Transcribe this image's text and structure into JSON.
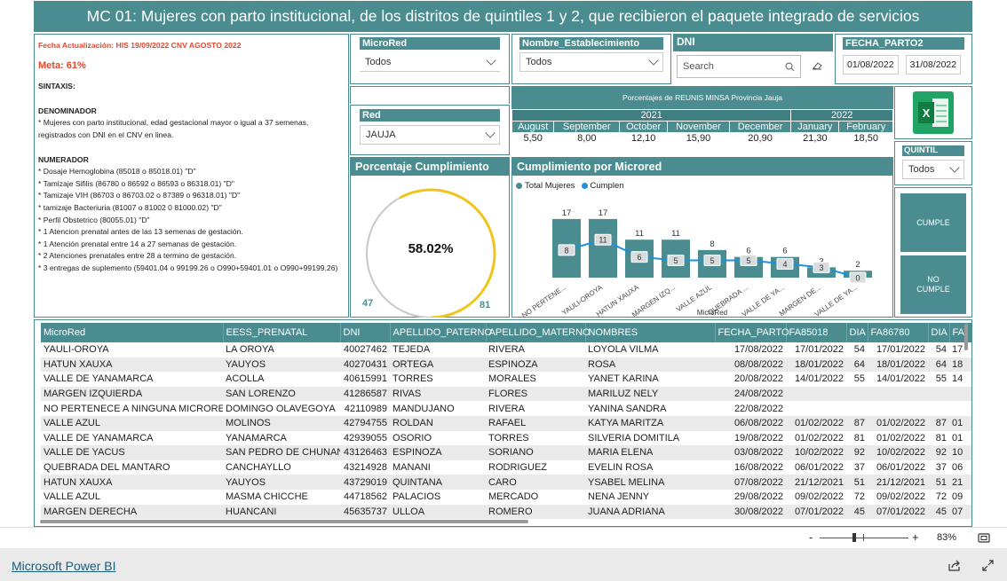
{
  "title": "MC 01: Mujeres con parto institucional, de los distritos de quintiles 1 y 2, que  recibieron el paquete integrado de servicios",
  "info": {
    "update": "Fecha Actualización:  HIS 19/09/2022  CNV AGOSTO 2022",
    "meta": "Meta: 61%",
    "sintaxis": "SINTAXIS:",
    "denominador_title": "DENOMINADOR",
    "denominador_text": "* Mujeres con parto institucional, edad gestacional mayor o igual a 37 semenas, registrados con DNI en el CNV en linea.",
    "numerador_title": "NUMERADOR",
    "numerador_items": [
      "*  Dosaje Hemoglobina (85018 o 85018.01) \"D\"",
      "* Tamizaje Sifilis (86780 o 86592 o 86593 o 86318.01) \"D\"",
      "* Tamizaje VIH (86703 o 86703.02 o 87389 o 96318.01) \"D\"",
      "* tamizaje Bacteriuria (81007 o 81002 0 81000.02) \"D\"",
      "* Perfil Obstetrico (80055.01) \"D\"",
      "* 1 Atencion prenatal antes de las 13 semenas de gestación.",
      "* 1 Atención prenatal entre 14 a 27 semanas de gestación.",
      "* 2 Atenciones prenatales entre 28 a termino de gestación.",
      "* 3 entregas de suplemento (59401.04 o 99199.26 o O990+59401.01 o O990+99199.26)"
    ]
  },
  "slicers": {
    "microred_label": "MicroRed",
    "microred_value": "Todos",
    "establecimiento_label": "Nombre_Establecimiento",
    "establecimiento_value": "Todos",
    "dni_label": "DNI",
    "dni_placeholder": "Search",
    "fecha_label": "FECHA_PARTO2",
    "fecha_from": "01/08/2022",
    "fecha_to": "31/08/2022",
    "red_label": "Red",
    "red_value": "JAUJA",
    "quintil_label": "QUINTIL",
    "quintil_value": "Todos"
  },
  "pct_table": {
    "title": "Porcentajes de REUNIS MINSA Provincia Jauja",
    "year1": "2021",
    "year2": "2022",
    "months": [
      "August",
      "September",
      "October",
      "November",
      "December",
      "January",
      "February"
    ],
    "values": [
      "5,50",
      "8,00",
      "12,10",
      "15,90",
      "20,90",
      "21,30",
      "18,50"
    ]
  },
  "gauge": {
    "title": "Porcentaje Cumplimiento",
    "value_label": "58.02%",
    "value": 58.02,
    "min_label": "47",
    "max_label": "81",
    "color": "#f0c419"
  },
  "chart_title": "Cumplimiento por Microred",
  "chart_data": {
    "type": "bar",
    "xlabel": "MicroRed",
    "categories": [
      "NO PERTENE...",
      "YAULI-OROYA",
      "HATUN XAUXA",
      "MARGEN IZQ...",
      "VALLE AZUL",
      "QUEBRADA ...",
      "VALLE DE YA...",
      "MARGEN DE...",
      "VALLE DE YA..."
    ],
    "series": [
      {
        "name": "Total Mujeres",
        "type": "bar",
        "color": "#4a8c8f",
        "values": [
          17,
          17,
          11,
          11,
          8,
          6,
          6,
          3,
          2
        ]
      },
      {
        "name": "Cumplen",
        "type": "line",
        "color": "#1e90e0",
        "values": [
          8,
          11,
          6,
          5,
          5,
          5,
          4,
          3,
          0
        ]
      }
    ],
    "ylim": [
      0,
      18
    ]
  },
  "buttons": {
    "cumple": "CUMPLE",
    "no_cumple": "NO CUMPLE"
  },
  "table": {
    "headers": [
      "MicroRed",
      "EESS_PRENATAL",
      "DNI",
      "APELLIDO_PATERNO",
      "APELLIDO_MATERNO",
      "NOMBRES",
      "FECHA_PARTO",
      "FA85018",
      "DIA",
      "FA86780",
      "DIA",
      "FA"
    ],
    "rows": [
      [
        "YAULI-OROYA",
        "LA OROYA",
        "40027462",
        "TEJEDA",
        "RIVERA",
        "LOYOLA VILMA",
        "17/08/2022",
        "17/01/2022",
        "54",
        "17/01/2022",
        "54",
        "17"
      ],
      [
        "HATUN XAUXA",
        "YAUYOS",
        "40270431",
        "ORTEGA",
        "ESPINOZA",
        "ROSA",
        "08/08/2022",
        "18/01/2022",
        "64",
        "18/01/2022",
        "64",
        "18"
      ],
      [
        "VALLE DE YANAMARCA",
        "ACOLLA",
        "40615991",
        "TORRES",
        "MORALES",
        "YANET KARINA",
        "20/08/2022",
        "14/01/2022",
        "55",
        "14/01/2022",
        "55",
        "14"
      ],
      [
        "MARGEN IZQUIERDA",
        "SAN LORENZO",
        "41286587",
        "RIVAS",
        "FLORES",
        "MARILUZ NELY",
        "24/08/2022",
        "",
        "",
        "",
        "",
        ""
      ],
      [
        "NO PERTENECE A NINGUNA MICRORED",
        "DOMINGO OLAVEGOYA",
        "42110989",
        "MANDUJANO",
        "RIVERA",
        "YANINA SANDRA",
        "22/08/2022",
        "",
        "",
        "",
        "",
        ""
      ],
      [
        "VALLE AZUL",
        "MOLINOS",
        "42794755",
        "ROLDAN",
        "RAFAEL",
        "KATYA MARITZA",
        "06/08/2022",
        "01/02/2022",
        "87",
        "01/02/2022",
        "87",
        "01"
      ],
      [
        "VALLE DE YANAMARCA",
        "YANAMARCA",
        "42939055",
        "OSORIO",
        "TORRES",
        "SILVERIA DOMITILA",
        "19/08/2022",
        "01/02/2022",
        "81",
        "01/02/2022",
        "81",
        "01"
      ],
      [
        "VALLE DE YACUS",
        "SAN PEDRO DE CHUNAN",
        "43126463",
        "ESPINOZA",
        "SORIANO",
        "MARIA ELENA",
        "03/08/2022",
        "10/02/2022",
        "92",
        "10/02/2022",
        "92",
        "10"
      ],
      [
        "QUEBRADA DEL MANTARO",
        "CANCHAYLLO",
        "43214928",
        "MANANI",
        "RODRIGUEZ",
        "EVELIN ROSA",
        "16/08/2022",
        "06/01/2022",
        "37",
        "06/01/2022",
        "37",
        "06"
      ],
      [
        "HATUN XAUXA",
        "YAUYOS",
        "43729019",
        "QUINTANA",
        "CARO",
        "YSABEL MELINA",
        "07/08/2022",
        "21/12/2021",
        "51",
        "21/12/2021",
        "51",
        "21"
      ],
      [
        "VALLE AZUL",
        "MASMA CHICCHE",
        "44718562",
        "PALACIOS",
        "MERCADO",
        "NENA JENNY",
        "29/08/2022",
        "09/02/2022",
        "72",
        "09/02/2022",
        "72",
        "09"
      ],
      [
        "MARGEN DERECHA",
        "HUANCANI",
        "45635737",
        "ULLOA",
        "ROMERO",
        "JUANA ADRIANA",
        "30/08/2022",
        "07/01/2022",
        "45",
        "07/01/2022",
        "45",
        "07"
      ]
    ]
  },
  "zoom": {
    "level": "83%",
    "minus": "-",
    "plus": "+"
  },
  "footer": {
    "brand": "Microsoft Power BI"
  }
}
